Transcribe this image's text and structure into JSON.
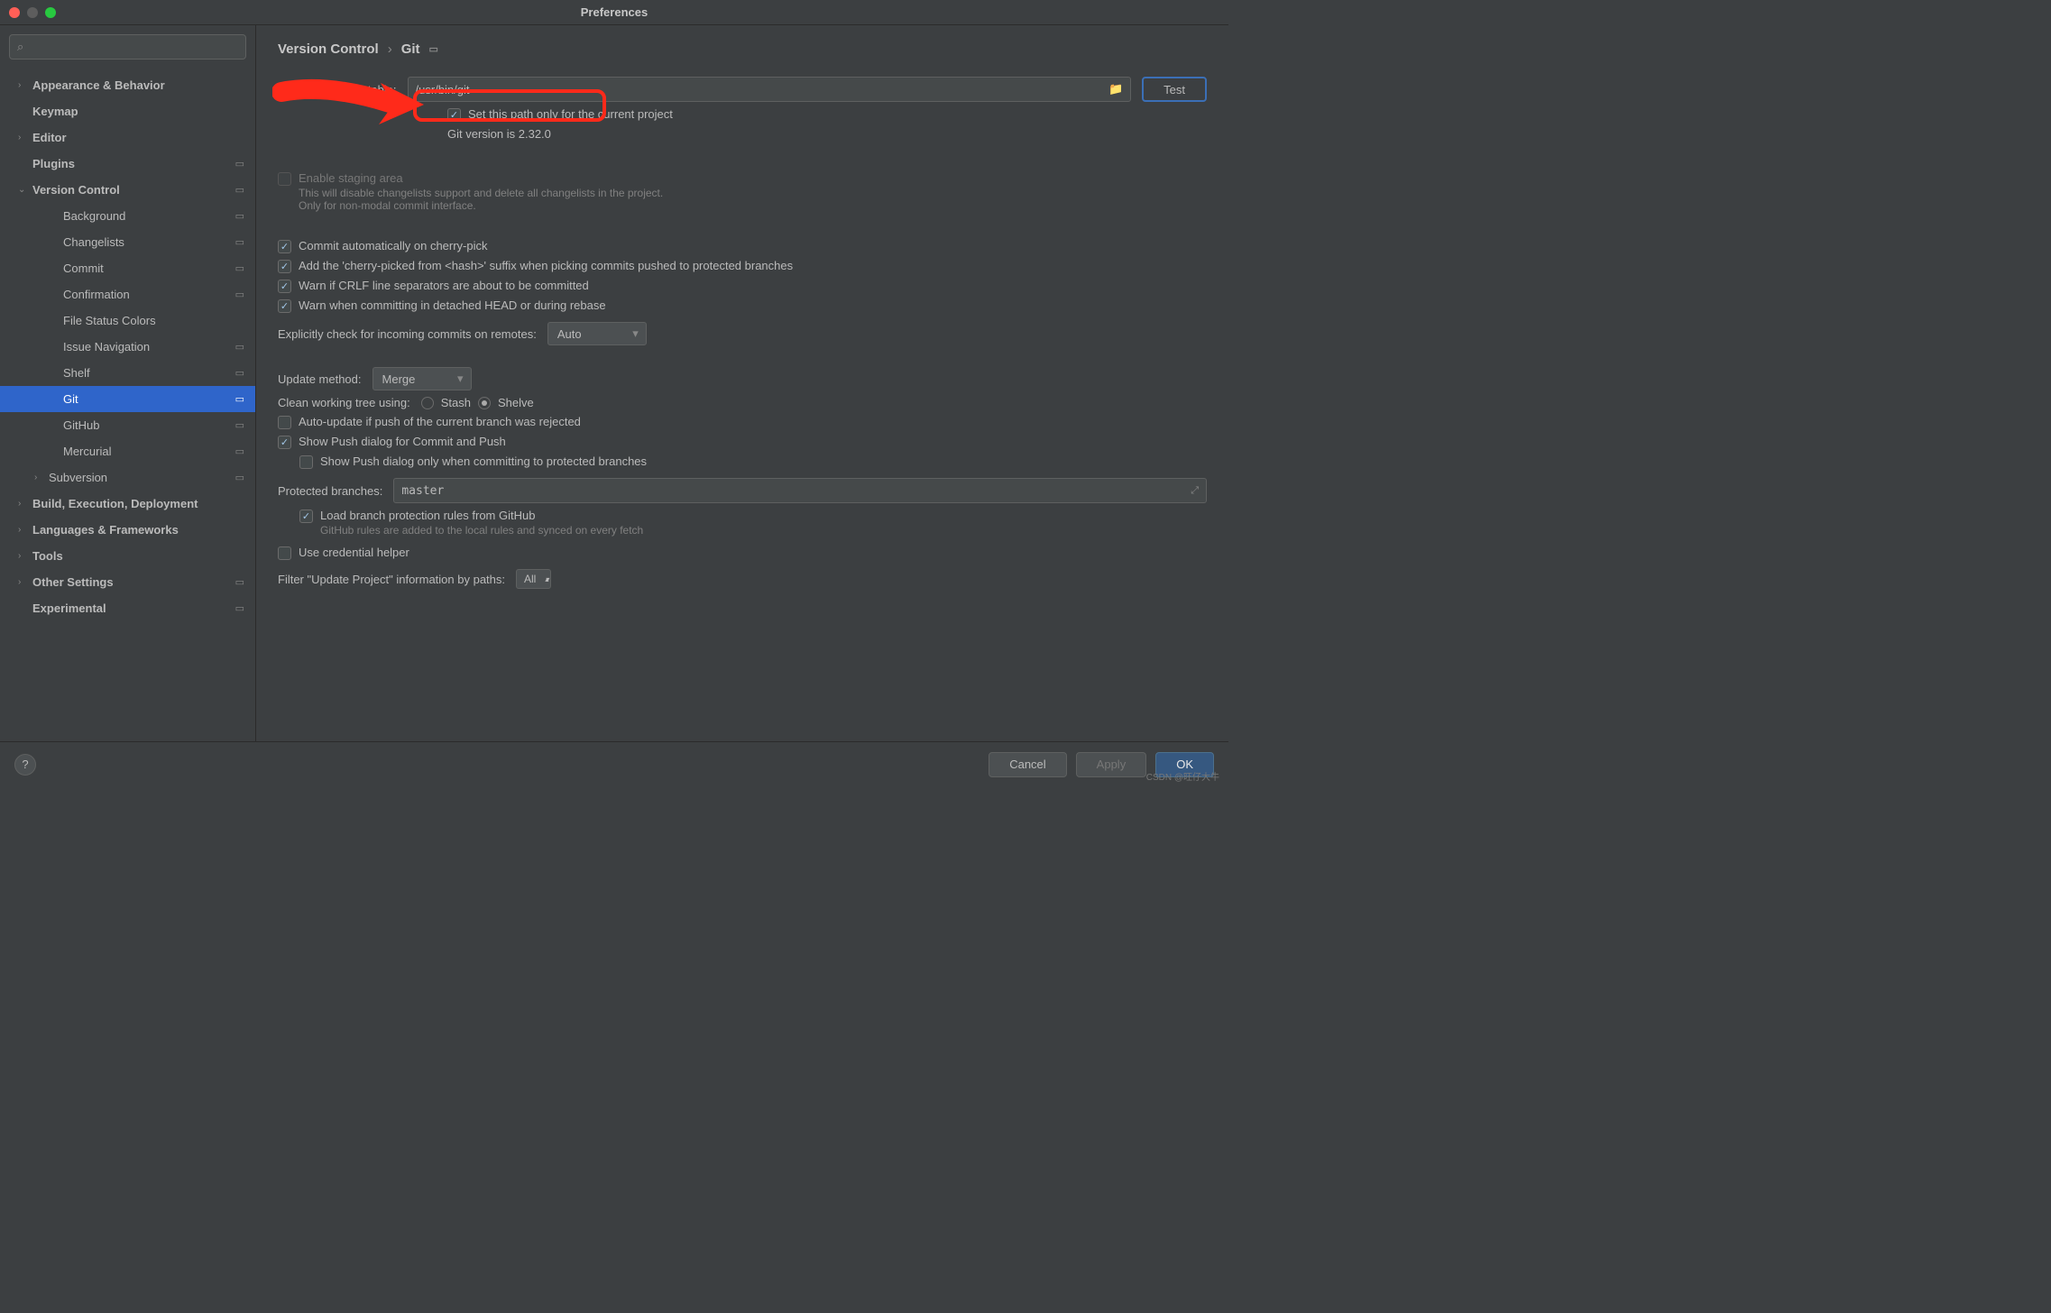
{
  "window": {
    "title": "Preferences"
  },
  "breadcrumb": {
    "parent": "Version Control",
    "current": "Git"
  },
  "sidebar": {
    "items": [
      {
        "label": "Appearance & Behavior",
        "bold": true,
        "arrow": "›",
        "depth": 0
      },
      {
        "label": "Keymap",
        "bold": true,
        "depth": 0
      },
      {
        "label": "Editor",
        "bold": true,
        "arrow": "›",
        "depth": 0
      },
      {
        "label": "Plugins",
        "bold": true,
        "depth": 0,
        "badge": true
      },
      {
        "label": "Version Control",
        "bold": true,
        "arrow": "⌄",
        "depth": 0,
        "badge": true
      },
      {
        "label": "Background",
        "depth": 2,
        "badge": true
      },
      {
        "label": "Changelists",
        "depth": 2,
        "badge": true
      },
      {
        "label": "Commit",
        "depth": 2,
        "badge": true
      },
      {
        "label": "Confirmation",
        "depth": 2,
        "badge": true
      },
      {
        "label": "File Status Colors",
        "depth": 2
      },
      {
        "label": "Issue Navigation",
        "depth": 2,
        "badge": true
      },
      {
        "label": "Shelf",
        "depth": 2,
        "badge": true
      },
      {
        "label": "Git",
        "depth": 2,
        "badge": true,
        "selected": true
      },
      {
        "label": "GitHub",
        "depth": 2,
        "badge": true
      },
      {
        "label": "Mercurial",
        "depth": 2,
        "badge": true
      },
      {
        "label": "Subversion",
        "arrow": "›",
        "depth": 1,
        "badge": true
      },
      {
        "label": "Build, Execution, Deployment",
        "bold": true,
        "arrow": "›",
        "depth": 0
      },
      {
        "label": "Languages & Frameworks",
        "bold": true,
        "arrow": "›",
        "depth": 0
      },
      {
        "label": "Tools",
        "bold": true,
        "arrow": "›",
        "depth": 0
      },
      {
        "label": "Other Settings",
        "bold": true,
        "arrow": "›",
        "depth": 0,
        "badge": true
      },
      {
        "label": "Experimental",
        "bold": true,
        "depth": 0,
        "badge": true
      }
    ]
  },
  "form": {
    "path_label": "Path to Git executable:",
    "path_value": "/usr/bin/git",
    "test_button": "Test",
    "set_path_project": "Set this path only for the current project",
    "git_version": "Git version is 2.32.0",
    "enable_staging": "Enable staging area",
    "enable_staging_help": "This will disable changelists support and delete all changelists in the project. Only for non-modal commit interface.",
    "commit_cherry": "Commit automatically on cherry-pick",
    "add_suffix": "Add the 'cherry-picked from <hash>' suffix when picking commits pushed to protected branches",
    "warn_crlf": "Warn if CRLF line separators are about to be committed",
    "warn_detached": "Warn when committing in detached HEAD or during rebase",
    "explicit_check_label": "Explicitly check for incoming commits on remotes:",
    "explicit_check_value": "Auto",
    "update_method_label": "Update method:",
    "update_method_value": "Merge",
    "clean_tree_label": "Clean working tree using:",
    "stash": "Stash",
    "shelve": "Shelve",
    "auto_update": "Auto-update if push of the current branch was rejected",
    "show_push": "Show Push dialog for Commit and Push",
    "show_push_protected": "Show Push dialog only when committing to protected branches",
    "protected_label": "Protected branches:",
    "protected_value": "master",
    "load_branch": "Load branch protection rules from GitHub",
    "load_branch_help": "GitHub rules are added to the local rules and synced on every fetch",
    "use_credential": "Use credential helper",
    "filter_label": "Filter \"Update Project\" information by paths:",
    "filter_value": "All"
  },
  "footer": {
    "cancel": "Cancel",
    "apply": "Apply",
    "ok": "OK"
  },
  "watermark": "CSDN @旺仔大牛"
}
